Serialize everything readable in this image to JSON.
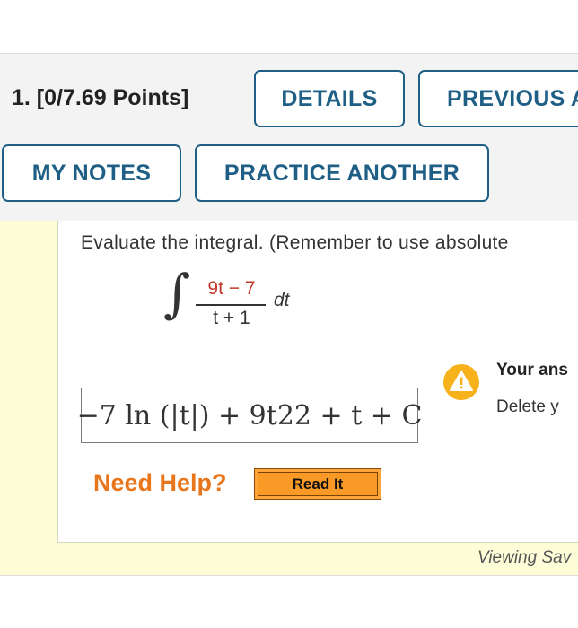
{
  "question": {
    "number_points": "1.  [0/7.69 Points]",
    "buttons": {
      "details": "DETAILS",
      "previous_answers": "PREVIOUS A",
      "my_notes": "MY NOTES",
      "practice_another": "PRACTICE ANOTHER"
    },
    "prompt": "Evaluate the integral. (Remember to use absolute",
    "integral": {
      "sign": "∫",
      "numerator": "9t − 7",
      "denominator": "t + 1",
      "differential": "dt"
    },
    "answer": "−7 ln (|t|) + 9t22 + t + C",
    "feedback": {
      "title": "Your ans",
      "text": "Delete y"
    },
    "help": {
      "label": "Need Help?",
      "read_it": "Read It"
    },
    "footer_note": "Viewing Sav"
  },
  "icons": {
    "warning": "warning-icon"
  },
  "colors": {
    "button_blue": "#1f5f86",
    "help_orange": "#e8761c",
    "read_it_fill": "#f99a26",
    "warning_yellow": "#f7b11b",
    "panel_yellow": "#fdfdd8",
    "numerator_red": "#c0392b"
  }
}
